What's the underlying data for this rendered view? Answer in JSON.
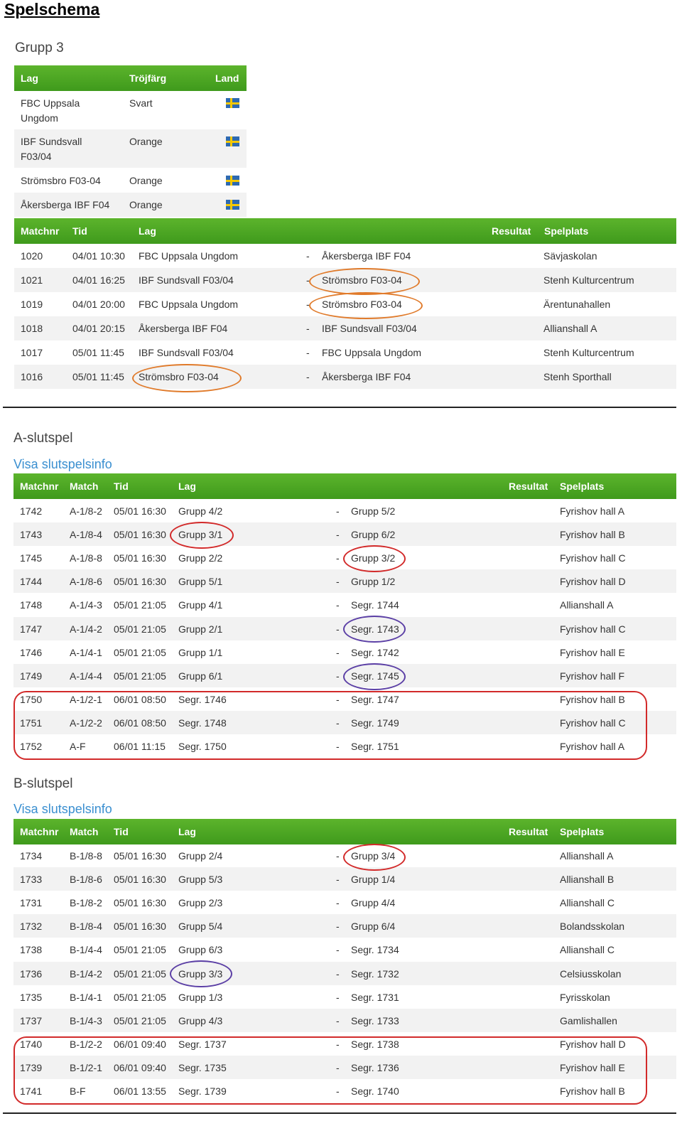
{
  "page_title": "Spelschema",
  "group": {
    "title": "Grupp 3",
    "team_headers": {
      "lag": "Lag",
      "trojfarg": "Tröjfärg",
      "land": "Land"
    },
    "teams": [
      {
        "lag_line1": "FBC Uppsala",
        "lag_line2": "Ungdom",
        "trojfarg": "Svart",
        "flag": "sweden-flag-icon"
      },
      {
        "lag_line1": "IBF Sundsvall",
        "lag_line2": "F03/04",
        "trojfarg": "Orange",
        "flag": "sweden-flag-icon"
      },
      {
        "lag_line1": "Strömsbro F03-04",
        "lag_line2": "",
        "trojfarg": "Orange",
        "flag": "sweden-flag-icon"
      },
      {
        "lag_line1": "Åkersberga IBF F04",
        "lag_line2": "",
        "trojfarg": "Orange",
        "flag": "sweden-flag-icon"
      }
    ],
    "match_headers": {
      "matchnr": "Matchnr",
      "tid": "Tid",
      "lag": "Lag",
      "resultat": "Resultat",
      "spelplats": "Spelplats"
    },
    "matches": [
      {
        "nr": "1020",
        "tid": "04/01 10:30",
        "home": "FBC Uppsala Ungdom",
        "sep": "-",
        "away": "Åkersberga IBF F04",
        "plats": "Sävjaskolan"
      },
      {
        "nr": "1021",
        "tid": "04/01 16:25",
        "home": "IBF Sundsvall F03/04",
        "sep": "-",
        "away": "Strömsbro F03-04",
        "plats": "Stenh Kulturcentrum"
      },
      {
        "nr": "1019",
        "tid": "04/01 20:00",
        "home": "FBC Uppsala Ungdom",
        "sep": "-",
        "away": "Strömsbro F03-04",
        "plats": "Ärentunahallen"
      },
      {
        "nr": "1018",
        "tid": "04/01 20:15",
        "home": "Åkersberga IBF F04",
        "sep": "-",
        "away": "IBF Sundsvall F03/04",
        "plats": "Allianshall A"
      },
      {
        "nr": "1017",
        "tid": "05/01 11:45",
        "home": "IBF Sundsvall F03/04",
        "sep": "-",
        "away": "FBC Uppsala Ungdom",
        "plats": "Stenh Kulturcentrum"
      },
      {
        "nr": "1016",
        "tid": "05/01 11:45",
        "home": "Strömsbro F03-04",
        "sep": "-",
        "away": "Åkersberga IBF F04",
        "plats": "Stenh Sporthall"
      }
    ]
  },
  "playoff_headers": {
    "matchnr": "Matchnr",
    "match": "Match",
    "tid": "Tid",
    "lag": "Lag",
    "resultat": "Resultat",
    "spelplats": "Spelplats"
  },
  "a_slutspel": {
    "title": "A-slutspel",
    "link": "Visa slutspelsinfo",
    "matches": [
      {
        "nr": "1742",
        "match": "A-1/8-2",
        "tid": "05/01 16:30",
        "home": "Grupp 4/2",
        "sep": "-",
        "away": "Grupp 5/2",
        "plats": "Fyrishov hall A"
      },
      {
        "nr": "1743",
        "match": "A-1/8-4",
        "tid": "05/01 16:30",
        "home": "Grupp 3/1",
        "sep": "-",
        "away": "Grupp 6/2",
        "plats": "Fyrishov hall B"
      },
      {
        "nr": "1745",
        "match": "A-1/8-8",
        "tid": "05/01 16:30",
        "home": "Grupp 2/2",
        "sep": "-",
        "away": "Grupp 3/2",
        "plats": "Fyrishov hall C"
      },
      {
        "nr": "1744",
        "match": "A-1/8-6",
        "tid": "05/01 16:30",
        "home": "Grupp 5/1",
        "sep": "-",
        "away": "Grupp 1/2",
        "plats": "Fyrishov hall D"
      },
      {
        "nr": "1748",
        "match": "A-1/4-3",
        "tid": "05/01 21:05",
        "home": "Grupp 4/1",
        "sep": "-",
        "away": "Segr. 1744",
        "plats": "Allianshall A"
      },
      {
        "nr": "1747",
        "match": "A-1/4-2",
        "tid": "05/01 21:05",
        "home": "Grupp 2/1",
        "sep": "-",
        "away": "Segr. 1743",
        "plats": "Fyrishov hall C"
      },
      {
        "nr": "1746",
        "match": "A-1/4-1",
        "tid": "05/01 21:05",
        "home": "Grupp 1/1",
        "sep": "-",
        "away": "Segr. 1742",
        "plats": "Fyrishov hall E"
      },
      {
        "nr": "1749",
        "match": "A-1/4-4",
        "tid": "05/01 21:05",
        "home": "Grupp 6/1",
        "sep": "-",
        "away": "Segr. 1745",
        "plats": "Fyrishov hall F"
      },
      {
        "nr": "1750",
        "match": "A-1/2-1",
        "tid": "06/01 08:50",
        "home": "Segr. 1746",
        "sep": "-",
        "away": "Segr. 1747",
        "plats": "Fyrishov hall B"
      },
      {
        "nr": "1751",
        "match": "A-1/2-2",
        "tid": "06/01 08:50",
        "home": "Segr. 1748",
        "sep": "-",
        "away": "Segr. 1749",
        "plats": "Fyrishov hall C"
      },
      {
        "nr": "1752",
        "match": "A-F",
        "tid": "06/01 11:15",
        "home": "Segr. 1750",
        "sep": "-",
        "away": "Segr. 1751",
        "plats": "Fyrishov hall A"
      }
    ]
  },
  "b_slutspel": {
    "title": "B-slutspel",
    "link": "Visa slutspelsinfo",
    "matches": [
      {
        "nr": "1734",
        "match": "B-1/8-8",
        "tid": "05/01 16:30",
        "home": "Grupp 2/4",
        "sep": "-",
        "away": "Grupp 3/4",
        "plats": "Allianshall A"
      },
      {
        "nr": "1733",
        "match": "B-1/8-6",
        "tid": "05/01 16:30",
        "home": "Grupp 5/3",
        "sep": "-",
        "away": "Grupp 1/4",
        "plats": "Allianshall B"
      },
      {
        "nr": "1731",
        "match": "B-1/8-2",
        "tid": "05/01 16:30",
        "home": "Grupp 2/3",
        "sep": "-",
        "away": "Grupp 4/4",
        "plats": "Allianshall C"
      },
      {
        "nr": "1732",
        "match": "B-1/8-4",
        "tid": "05/01 16:30",
        "home": "Grupp 5/4",
        "sep": "-",
        "away": "Grupp 6/4",
        "plats": "Bolandsskolan"
      },
      {
        "nr": "1738",
        "match": "B-1/4-4",
        "tid": "05/01 21:05",
        "home": "Grupp 6/3",
        "sep": "-",
        "away": "Segr. 1734",
        "plats": "Allianshall C"
      },
      {
        "nr": "1736",
        "match": "B-1/4-2",
        "tid": "05/01 21:05",
        "home": "Grupp 3/3",
        "sep": "-",
        "away": "Segr. 1732",
        "plats": "Celsiusskolan"
      },
      {
        "nr": "1735",
        "match": "B-1/4-1",
        "tid": "05/01 21:05",
        "home": "Grupp 1/3",
        "sep": "-",
        "away": "Segr. 1731",
        "plats": "Fyrisskolan"
      },
      {
        "nr": "1737",
        "match": "B-1/4-3",
        "tid": "05/01 21:05",
        "home": "Grupp 4/3",
        "sep": "-",
        "away": "Segr. 1733",
        "plats": "Gamlishallen"
      },
      {
        "nr": "1740",
        "match": "B-1/2-2",
        "tid": "06/01 09:40",
        "home": "Segr. 1737",
        "sep": "-",
        "away": "Segr. 1738",
        "plats": "Fyrishov hall D"
      },
      {
        "nr": "1739",
        "match": "B-1/2-1",
        "tid": "06/01 09:40",
        "home": "Segr. 1735",
        "sep": "-",
        "away": "Segr. 1736",
        "plats": "Fyrishov hall E"
      },
      {
        "nr": "1741",
        "match": "B-F",
        "tid": "06/01 13:55",
        "home": "Segr. 1739",
        "sep": "-",
        "away": "Segr. 1740",
        "plats": "Fyrishov hall B"
      }
    ]
  },
  "colors": {
    "header_green": "#4aa623",
    "link_blue": "#3a8fd0",
    "annotation_orange": "#e07a2a",
    "annotation_red": "#d22a2a",
    "annotation_purple": "#5b3fa5"
  }
}
